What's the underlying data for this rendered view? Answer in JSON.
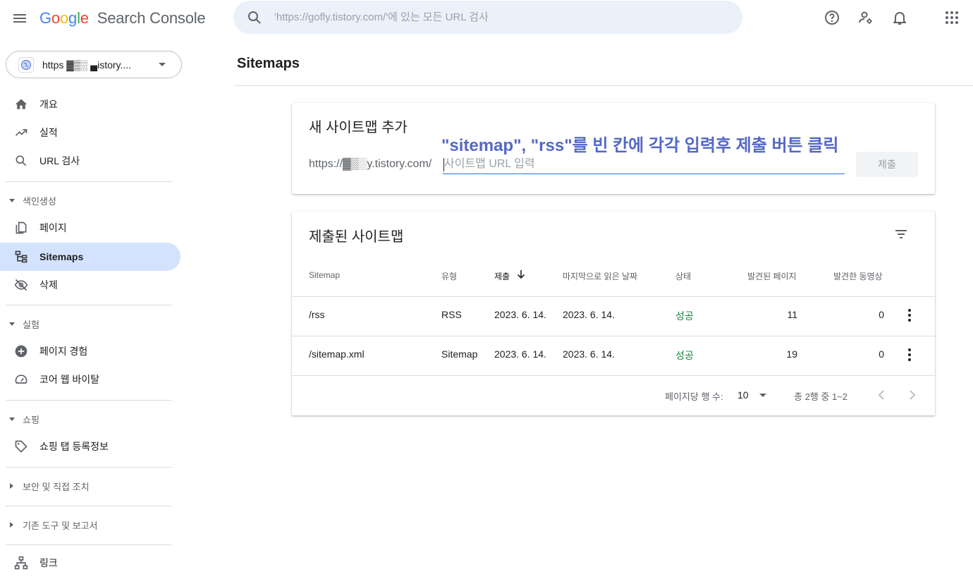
{
  "header": {
    "logo_letters": [
      "G",
      "o",
      "o",
      "g",
      "l",
      "e"
    ],
    "product": "Search Console",
    "search_placeholder": "'https://gofly.tistory.com/'에 있는 모든 URL 검사"
  },
  "sidebar": {
    "property_label": "https ▓▒░ ▄istory....",
    "items": [
      {
        "label": "개요"
      },
      {
        "label": "실적"
      },
      {
        "label": "URL 검사"
      }
    ],
    "sections": [
      {
        "label": "색인생성",
        "items": [
          {
            "label": "페이지"
          },
          {
            "label": "Sitemaps"
          },
          {
            "label": "삭제"
          }
        ]
      },
      {
        "label": "실험",
        "items": [
          {
            "label": "페이지 경험"
          },
          {
            "label": "코어 웹 바이탈"
          }
        ]
      },
      {
        "label": "쇼핑",
        "items": [
          {
            "label": "쇼핑 탭 등록정보"
          }
        ]
      },
      {
        "label": "보안 및 직접 조치"
      },
      {
        "label": "기존 도구 및 보고서"
      }
    ],
    "bottom_items": [
      {
        "label": "링크"
      }
    ]
  },
  "main": {
    "page_title": "Sitemaps",
    "add_card": {
      "title": "새 사이트맵 추가",
      "annotation": "\"sitemap\", \"rss\"를 빈 칸에 각각 입력후 제출 버튼 클릭",
      "url_prefix": "https://▓▒░y.tistory.com/",
      "input_placeholder": "사이트맵 URL 입력",
      "input_value": "",
      "submit_label": "제출"
    },
    "submitted_card": {
      "title": "제출된 사이트맵",
      "columns": [
        "Sitemap",
        "유형",
        "제출",
        "마지막으로 읽은 날짜",
        "상태",
        "발견된 페이지",
        "발견한 동영상"
      ],
      "rows": [
        {
          "sitemap": "/rss",
          "type": "RSS",
          "submitted": "2023. 6. 14.",
          "last_read": "2023. 6. 14.",
          "status": "성공",
          "pages": "11",
          "videos": "0"
        },
        {
          "sitemap": "/sitemap.xml",
          "type": "Sitemap",
          "submitted": "2023. 6. 14.",
          "last_read": "2023. 6. 14.",
          "status": "성공",
          "pages": "19",
          "videos": "0"
        }
      ],
      "footer": {
        "rows_per_page_label": "페이지당 행 수:",
        "rows_per_page_value": "10",
        "range_label": "총 2행 중 1~2"
      }
    }
  },
  "colors": {
    "accent": "#1a73e8",
    "active_nav_bg": "#d3e3fd",
    "success": "#188038",
    "annotation": "#5468c6"
  },
  "icons": [
    "menu-icon",
    "search-icon",
    "help-icon",
    "admin-settings-icon",
    "notifications-icon",
    "apps-icon",
    "globe-icon",
    "home-icon",
    "trending-up-icon",
    "search-icon",
    "pages-icon",
    "sitemap-icon",
    "visibility-off-icon",
    "add-circle-icon",
    "speed-icon",
    "sell-tag-icon",
    "links-icon",
    "filter-icon",
    "arrow-down-icon",
    "more-vert-icon",
    "chevron-left-icon",
    "chevron-right-icon"
  ]
}
